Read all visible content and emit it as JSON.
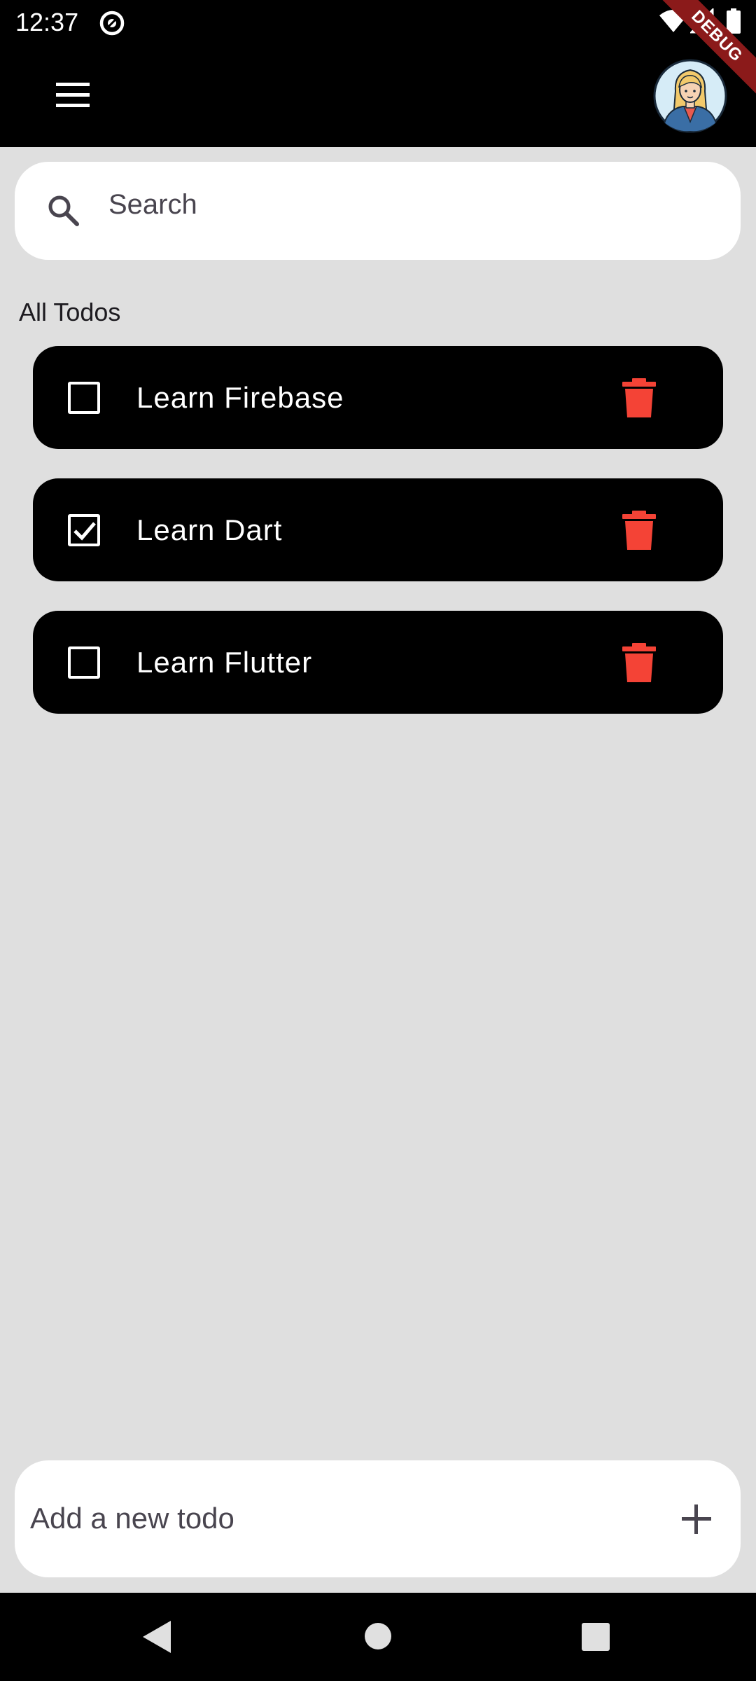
{
  "status_bar": {
    "time": "12:37",
    "icons": [
      "app-notification-icon",
      "wifi-icon",
      "signal-icon",
      "battery-icon"
    ]
  },
  "debug_banner": "DEBUG",
  "app_bar": {
    "menu_icon": "hamburger-menu-icon",
    "avatar": "user-avatar"
  },
  "search": {
    "placeholder": "Search",
    "value": ""
  },
  "section_title": "All Todos",
  "todos": [
    {
      "label": "Learn Firebase",
      "checked": false
    },
    {
      "label": "Learn Dart",
      "checked": true
    },
    {
      "label": "Learn Flutter",
      "checked": false
    }
  ],
  "add_todo": {
    "placeholder": "Add a new todo",
    "value": ""
  },
  "nav_bar": {
    "buttons": [
      "back-icon",
      "home-icon",
      "recents-icon"
    ]
  },
  "colors": {
    "background": "#dfdfdf",
    "bar": "#000000",
    "delete": "#f44336",
    "ribbon": "#8b1a1a"
  }
}
